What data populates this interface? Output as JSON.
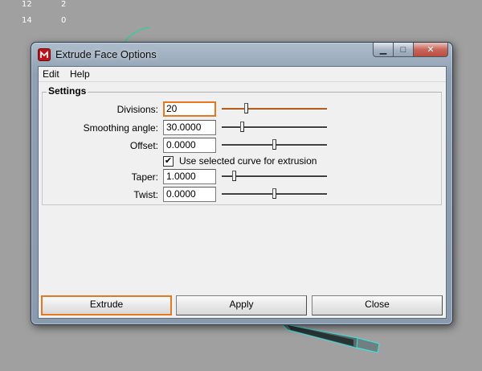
{
  "hud": {
    "row1": [
      "12",
      "2"
    ],
    "row2": [
      "14",
      "0"
    ]
  },
  "window": {
    "title": "Extrude Face Options",
    "icon": "maya-app-icon",
    "caption_buttons": {
      "minimize": "minimize-icon",
      "maximize": "maximize-icon",
      "close": "close-icon"
    }
  },
  "menu": [
    "Edit",
    "Help"
  ],
  "settings": {
    "label": "Settings",
    "divisions": {
      "label": "Divisions:",
      "value": "20",
      "slider_level": 0.22
    },
    "smoothing_angle": {
      "label": "Smoothing angle:",
      "value": "30.0000",
      "slider_level": 0.18
    },
    "offset": {
      "label": "Offset:",
      "value": "0.0000",
      "slider_level": 0.5
    },
    "use_curve": {
      "label": "Use selected curve for extrusion",
      "checked": true,
      "mark": "✔"
    },
    "taper": {
      "label": "Taper:",
      "value": "1.0000",
      "slider_level": 0.1
    },
    "twist": {
      "label": "Twist:",
      "value": "0.0000",
      "slider_level": 0.5
    }
  },
  "buttons": {
    "extrude": "Extrude",
    "apply": "Apply",
    "close": "Close"
  },
  "colors": {
    "accent": "#e87722",
    "background": "#a0a0a0",
    "dialog": "#f0f0f0"
  }
}
